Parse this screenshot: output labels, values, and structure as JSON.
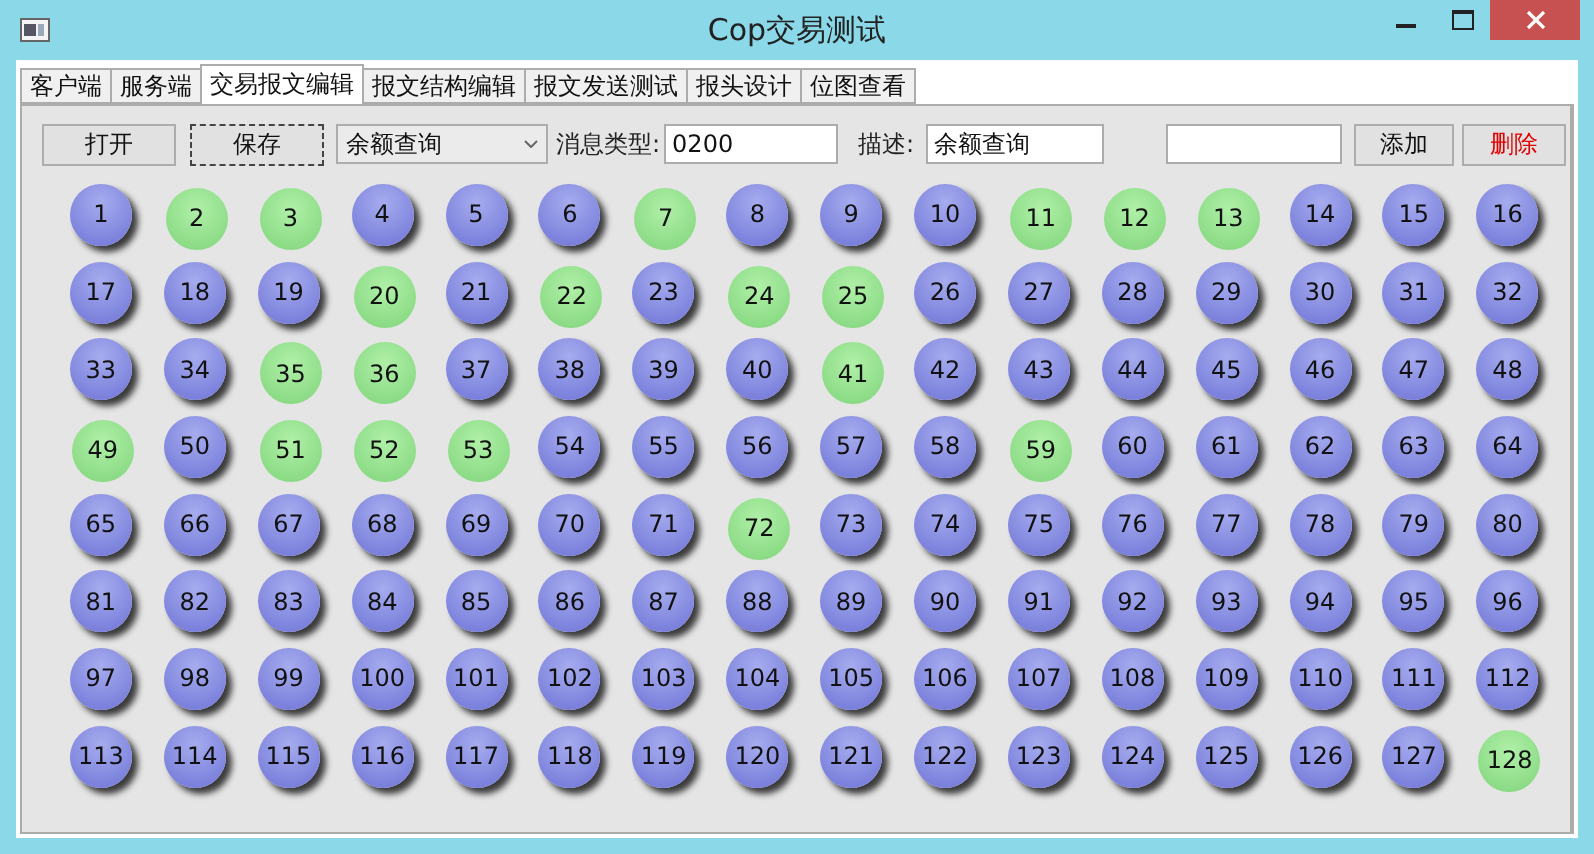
{
  "window": {
    "title": "Cop交易测试"
  },
  "tabs": [
    {
      "label": "客户端",
      "selected": false
    },
    {
      "label": "服务端",
      "selected": false
    },
    {
      "label": "交易报文编辑",
      "selected": true
    },
    {
      "label": "报文结构编辑",
      "selected": false
    },
    {
      "label": "报文发送测试",
      "selected": false
    },
    {
      "label": "报头设计",
      "selected": false
    },
    {
      "label": "位图查看",
      "selected": false
    }
  ],
  "toolbar": {
    "open_button": "打开",
    "save_button": "保存",
    "transaction_select": "余额查询",
    "message_type_label": "消息类型:",
    "message_type": "0200",
    "description_label": "描述:",
    "description": "余额查询",
    "add_button": "添加",
    "delete_button": "删除"
  },
  "bits": [
    {
      "label": "1",
      "selected": false
    },
    {
      "label": "2",
      "selected": true
    },
    {
      "label": "3",
      "selected": true
    },
    {
      "label": "4",
      "selected": false
    },
    {
      "label": "5",
      "selected": false
    },
    {
      "label": "6",
      "selected": false
    },
    {
      "label": "7",
      "selected": true
    },
    {
      "label": "8",
      "selected": false
    },
    {
      "label": "9",
      "selected": false
    },
    {
      "label": "10",
      "selected": false
    },
    {
      "label": "11",
      "selected": true
    },
    {
      "label": "12",
      "selected": true
    },
    {
      "label": "13",
      "selected": true
    },
    {
      "label": "14",
      "selected": false
    },
    {
      "label": "15",
      "selected": false
    },
    {
      "label": "16",
      "selected": false
    },
    {
      "label": "17",
      "selected": false
    },
    {
      "label": "18",
      "selected": false
    },
    {
      "label": "19",
      "selected": false
    },
    {
      "label": "20",
      "selected": true
    },
    {
      "label": "21",
      "selected": false
    },
    {
      "label": "22",
      "selected": true
    },
    {
      "label": "23",
      "selected": false
    },
    {
      "label": "24",
      "selected": true
    },
    {
      "label": "25",
      "selected": true
    },
    {
      "label": "26",
      "selected": false
    },
    {
      "label": "27",
      "selected": false
    },
    {
      "label": "28",
      "selected": false
    },
    {
      "label": "29",
      "selected": false
    },
    {
      "label": "30",
      "selected": false
    },
    {
      "label": "31",
      "selected": false
    },
    {
      "label": "32",
      "selected": false
    },
    {
      "label": "33",
      "selected": false
    },
    {
      "label": "34",
      "selected": false
    },
    {
      "label": "35",
      "selected": true
    },
    {
      "label": "36",
      "selected": true
    },
    {
      "label": "37",
      "selected": false
    },
    {
      "label": "38",
      "selected": false
    },
    {
      "label": "39",
      "selected": false
    },
    {
      "label": "40",
      "selected": false
    },
    {
      "label": "41",
      "selected": true
    },
    {
      "label": "42",
      "selected": false
    },
    {
      "label": "43",
      "selected": false
    },
    {
      "label": "44",
      "selected": false
    },
    {
      "label": "45",
      "selected": false
    },
    {
      "label": "46",
      "selected": false
    },
    {
      "label": "47",
      "selected": false
    },
    {
      "label": "48",
      "selected": false
    },
    {
      "label": "49",
      "selected": true
    },
    {
      "label": "50",
      "selected": false
    },
    {
      "label": "51",
      "selected": true
    },
    {
      "label": "52",
      "selected": true
    },
    {
      "label": "53",
      "selected": true
    },
    {
      "label": "54",
      "selected": false
    },
    {
      "label": "55",
      "selected": false
    },
    {
      "label": "56",
      "selected": false
    },
    {
      "label": "57",
      "selected": false
    },
    {
      "label": "58",
      "selected": false
    },
    {
      "label": "59",
      "selected": true
    },
    {
      "label": "60",
      "selected": false
    },
    {
      "label": "61",
      "selected": false
    },
    {
      "label": "62",
      "selected": false
    },
    {
      "label": "63",
      "selected": false
    },
    {
      "label": "64",
      "selected": false
    },
    {
      "label": "65",
      "selected": false
    },
    {
      "label": "66",
      "selected": false
    },
    {
      "label": "67",
      "selected": false
    },
    {
      "label": "68",
      "selected": false
    },
    {
      "label": "69",
      "selected": false
    },
    {
      "label": "70",
      "selected": false
    },
    {
      "label": "71",
      "selected": false
    },
    {
      "label": "72",
      "selected": true
    },
    {
      "label": "73",
      "selected": false
    },
    {
      "label": "74",
      "selected": false
    },
    {
      "label": "75",
      "selected": false
    },
    {
      "label": "76",
      "selected": false
    },
    {
      "label": "77",
      "selected": false
    },
    {
      "label": "78",
      "selected": false
    },
    {
      "label": "79",
      "selected": false
    },
    {
      "label": "80",
      "selected": false
    },
    {
      "label": "81",
      "selected": false
    },
    {
      "label": "82",
      "selected": false
    },
    {
      "label": "83",
      "selected": false
    },
    {
      "label": "84",
      "selected": false
    },
    {
      "label": "85",
      "selected": false
    },
    {
      "label": "86",
      "selected": false
    },
    {
      "label": "87",
      "selected": false
    },
    {
      "label": "88",
      "selected": false
    },
    {
      "label": "89",
      "selected": false
    },
    {
      "label": "90",
      "selected": false
    },
    {
      "label": "91",
      "selected": false
    },
    {
      "label": "92",
      "selected": false
    },
    {
      "label": "93",
      "selected": false
    },
    {
      "label": "94",
      "selected": false
    },
    {
      "label": "95",
      "selected": false
    },
    {
      "label": "96",
      "selected": false
    },
    {
      "label": "97",
      "selected": false
    },
    {
      "label": "98",
      "selected": false
    },
    {
      "label": "99",
      "selected": false
    },
    {
      "label": "100",
      "selected": false
    },
    {
      "label": "101",
      "selected": false
    },
    {
      "label": "102",
      "selected": false
    },
    {
      "label": "103",
      "selected": false
    },
    {
      "label": "104",
      "selected": false
    },
    {
      "label": "105",
      "selected": false
    },
    {
      "label": "106",
      "selected": false
    },
    {
      "label": "107",
      "selected": false
    },
    {
      "label": "108",
      "selected": false
    },
    {
      "label": "109",
      "selected": false
    },
    {
      "label": "110",
      "selected": false
    },
    {
      "label": "111",
      "selected": false
    },
    {
      "label": "112",
      "selected": false
    },
    {
      "label": "113",
      "selected": false
    },
    {
      "label": "114",
      "selected": false
    },
    {
      "label": "115",
      "selected": false
    },
    {
      "label": "116",
      "selected": false
    },
    {
      "label": "117",
      "selected": false
    },
    {
      "label": "118",
      "selected": false
    },
    {
      "label": "119",
      "selected": false
    },
    {
      "label": "120",
      "selected": false
    },
    {
      "label": "121",
      "selected": false
    },
    {
      "label": "122",
      "selected": false
    },
    {
      "label": "123",
      "selected": false
    },
    {
      "label": "124",
      "selected": false
    },
    {
      "label": "125",
      "selected": false
    },
    {
      "label": "126",
      "selected": false
    },
    {
      "label": "127",
      "selected": false
    },
    {
      "label": "128",
      "selected": true
    }
  ]
}
